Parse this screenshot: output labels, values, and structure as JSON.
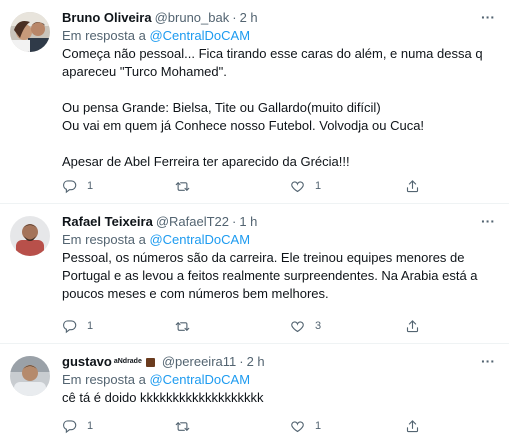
{
  "tweets": [
    {
      "name": "Bruno Oliveira",
      "handle": "@bruno_bak",
      "dot": "·",
      "time": "2 h",
      "reply_prefix": "Em resposta a ",
      "reply_to": "@CentralDoCAM",
      "body": "Começa não pessoal... Fica tirando esse caras do além, e numa dessa q\napareceu \"Turco Mohamed\".\n\nOu pensa Grande: Bielsa, Tite ou Gallardo(muito difícil)\nOu vai em quem já Conhece nosso Futebol. Volvodja ou Cuca!\n\nApesar de Abel Ferreira ter aparecido da Grécia!!!",
      "replies": "1",
      "retweets": "",
      "likes": "1",
      "more_label": "···"
    },
    {
      "name": "Rafael Teixeira",
      "handle": "@RafaelT22",
      "dot": "·",
      "time": "1 h",
      "reply_prefix": "Em resposta a ",
      "reply_to": "@CentralDoCAM",
      "body": "Pessoal, os números são da carreira. Ele treinou equipes menores de\nPortugal e as levou a feitos realmente surpreendentes. Na Arabia está a\npoucos meses e com números bem melhores.",
      "replies": "1",
      "retweets": "",
      "likes": "3",
      "more_label": "···"
    },
    {
      "name": "gustavo",
      "badge": "aNdrade",
      "handle": "@pereeira11",
      "dot": "·",
      "time": "2 h",
      "reply_prefix": "Em resposta a ",
      "reply_to": "@CentralDoCAM",
      "body": "cê tá é doido kkkkkkkkkkkkkkkkkkk",
      "replies": "1",
      "retweets": "",
      "likes": "1",
      "more_label": "···"
    }
  ],
  "colors": {
    "link": "#1d9bf0",
    "muted": "#536471",
    "text": "#0f1419",
    "divider": "#eff3f4"
  },
  "icons": [
    "reply-icon",
    "retweet-icon",
    "like-icon",
    "share-icon",
    "more-icon"
  ]
}
